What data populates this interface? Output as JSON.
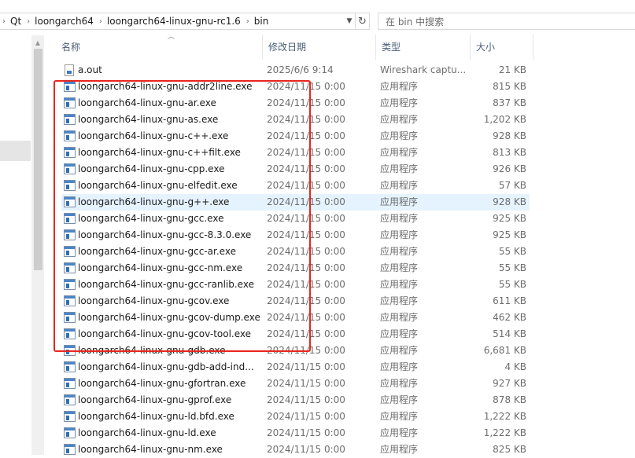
{
  "address_bar": {
    "crumbs": [
      "Qt",
      "loongarch64",
      "loongarch64-linux-gnu-rc1.6",
      "bin"
    ],
    "separator": "›"
  },
  "search": {
    "placeholder": "在 bin 中搜索"
  },
  "columns": {
    "name": "名称",
    "date": "修改日期",
    "type": "类型",
    "size": "大小"
  },
  "files": [
    {
      "name": "a.out",
      "date": "2025/6/6 9:14",
      "type": "Wireshark captu...",
      "size": "21 KB",
      "icon": "file-icon"
    },
    {
      "name": "loongarch64-linux-gnu-addr2line.exe",
      "date": "2024/11/15 0:00",
      "type": "应用程序",
      "size": "815 KB",
      "icon": "exe-icon"
    },
    {
      "name": "loongarch64-linux-gnu-ar.exe",
      "date": "2024/11/15 0:00",
      "type": "应用程序",
      "size": "837 KB",
      "icon": "exe-icon"
    },
    {
      "name": "loongarch64-linux-gnu-as.exe",
      "date": "2024/11/15 0:00",
      "type": "应用程序",
      "size": "1,202 KB",
      "icon": "exe-icon"
    },
    {
      "name": "loongarch64-linux-gnu-c++.exe",
      "date": "2024/11/15 0:00",
      "type": "应用程序",
      "size": "928 KB",
      "icon": "exe-icon"
    },
    {
      "name": "loongarch64-linux-gnu-c++filt.exe",
      "date": "2024/11/15 0:00",
      "type": "应用程序",
      "size": "813 KB",
      "icon": "exe-icon"
    },
    {
      "name": "loongarch64-linux-gnu-cpp.exe",
      "date": "2024/11/15 0:00",
      "type": "应用程序",
      "size": "926 KB",
      "icon": "exe-icon"
    },
    {
      "name": "loongarch64-linux-gnu-elfedit.exe",
      "date": "2024/11/15 0:00",
      "type": "应用程序",
      "size": "57 KB",
      "icon": "exe-icon"
    },
    {
      "name": "loongarch64-linux-gnu-g++.exe",
      "date": "2024/11/15 0:00",
      "type": "应用程序",
      "size": "928 KB",
      "icon": "exe-icon",
      "hover": true
    },
    {
      "name": "loongarch64-linux-gnu-gcc.exe",
      "date": "2024/11/15 0:00",
      "type": "应用程序",
      "size": "925 KB",
      "icon": "exe-icon"
    },
    {
      "name": "loongarch64-linux-gnu-gcc-8.3.0.exe",
      "date": "2024/11/15 0:00",
      "type": "应用程序",
      "size": "925 KB",
      "icon": "exe-icon"
    },
    {
      "name": "loongarch64-linux-gnu-gcc-ar.exe",
      "date": "2024/11/15 0:00",
      "type": "应用程序",
      "size": "55 KB",
      "icon": "exe-icon"
    },
    {
      "name": "loongarch64-linux-gnu-gcc-nm.exe",
      "date": "2024/11/15 0:00",
      "type": "应用程序",
      "size": "55 KB",
      "icon": "exe-icon"
    },
    {
      "name": "loongarch64-linux-gnu-gcc-ranlib.exe",
      "date": "2024/11/15 0:00",
      "type": "应用程序",
      "size": "55 KB",
      "icon": "exe-icon"
    },
    {
      "name": "loongarch64-linux-gnu-gcov.exe",
      "date": "2024/11/15 0:00",
      "type": "应用程序",
      "size": "611 KB",
      "icon": "exe-icon"
    },
    {
      "name": "loongarch64-linux-gnu-gcov-dump.exe",
      "date": "2024/11/15 0:00",
      "type": "应用程序",
      "size": "462 KB",
      "icon": "exe-icon"
    },
    {
      "name": "loongarch64-linux-gnu-gcov-tool.exe",
      "date": "2024/11/15 0:00",
      "type": "应用程序",
      "size": "514 KB",
      "icon": "exe-icon"
    },
    {
      "name": "loongarch64-linux-gnu-gdb.exe",
      "date": "2024/11/15 0:00",
      "type": "应用程序",
      "size": "6,681 KB",
      "icon": "exe-icon"
    },
    {
      "name": "loongarch64-linux-gnu-gdb-add-ind...",
      "date": "2024/11/15 0:00",
      "type": "应用程序",
      "size": "4 KB",
      "icon": "exe-icon"
    },
    {
      "name": "loongarch64-linux-gnu-gfortran.exe",
      "date": "2024/11/15 0:00",
      "type": "应用程序",
      "size": "927 KB",
      "icon": "exe-icon"
    },
    {
      "name": "loongarch64-linux-gnu-gprof.exe",
      "date": "2024/11/15 0:00",
      "type": "应用程序",
      "size": "878 KB",
      "icon": "exe-icon"
    },
    {
      "name": "loongarch64-linux-gnu-ld.bfd.exe",
      "date": "2024/11/15 0:00",
      "type": "应用程序",
      "size": "1,222 KB",
      "icon": "exe-icon"
    },
    {
      "name": "loongarch64-linux-gnu-ld.exe",
      "date": "2024/11/15 0:00",
      "type": "应用程序",
      "size": "1,222 KB",
      "icon": "exe-icon"
    },
    {
      "name": "loongarch64-linux-gnu-nm.exe",
      "date": "2024/11/15 0:00",
      "type": "应用程序",
      "size": "825 KB",
      "icon": "exe-icon"
    }
  ],
  "colors": {
    "annotation": "#e8261d",
    "hover_row": "#e5f3ff",
    "header_text": "#4c607a"
  }
}
